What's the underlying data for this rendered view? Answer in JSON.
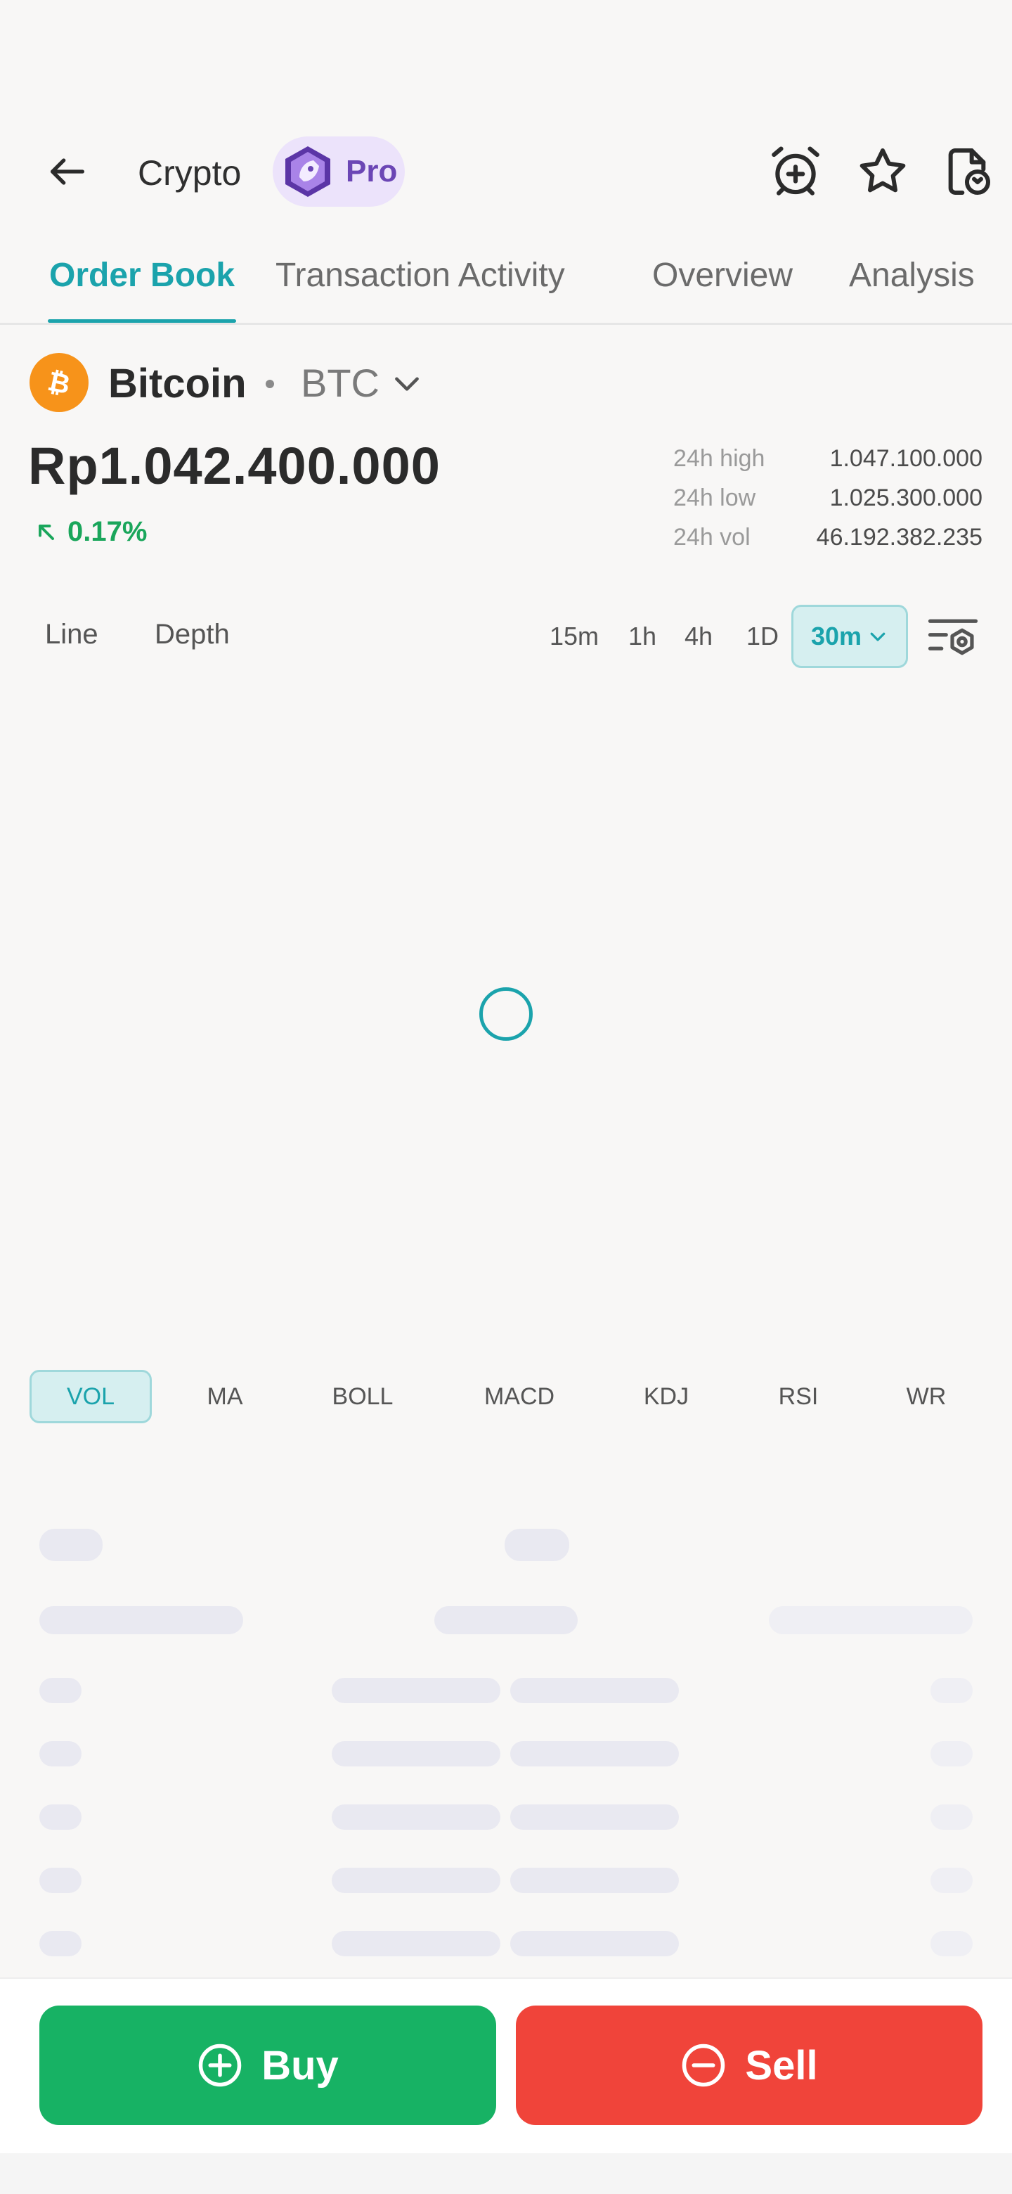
{
  "header": {
    "title": "Crypto",
    "badge_label": "Pro",
    "icons": [
      "back-arrow-icon",
      "alarm-add-icon",
      "star-icon",
      "document-sync-icon"
    ]
  },
  "tabs": [
    {
      "label": "Order Book",
      "active": true
    },
    {
      "label": "Transaction Activity",
      "active": false
    },
    {
      "label": "Overview",
      "active": false
    },
    {
      "label": "Analysis",
      "active": false
    }
  ],
  "coin": {
    "name": "Bitcoin",
    "symbol": "BTC",
    "price": "Rp1.042.400.000",
    "change": "0.17%",
    "change_direction": "up",
    "stats": [
      {
        "label": "24h high",
        "value": "1.047.100.000"
      },
      {
        "label": "24h low",
        "value": "1.025.300.000"
      },
      {
        "label": "24h vol",
        "value": "46.192.382.235"
      }
    ]
  },
  "chart": {
    "types": [
      "Line",
      "Depth"
    ],
    "timeframes": [
      "15m",
      "1h",
      "4h",
      "1D"
    ],
    "selected_timeframe": "30m",
    "loading": true
  },
  "indicators": [
    {
      "label": "VOL",
      "active": true
    },
    {
      "label": "MA",
      "active": false
    },
    {
      "label": "BOLL",
      "active": false
    },
    {
      "label": "MACD",
      "active": false
    },
    {
      "label": "KDJ",
      "active": false
    },
    {
      "label": "RSI",
      "active": false
    },
    {
      "label": "WR",
      "active": false
    }
  ],
  "actions": {
    "buy_label": "Buy",
    "sell_label": "Sell"
  },
  "colors": {
    "accent": "#1ba3ac",
    "buy": "#17b264",
    "sell": "#f0443a",
    "bitcoin": "#f7931a",
    "pro": "#6b46b5"
  }
}
